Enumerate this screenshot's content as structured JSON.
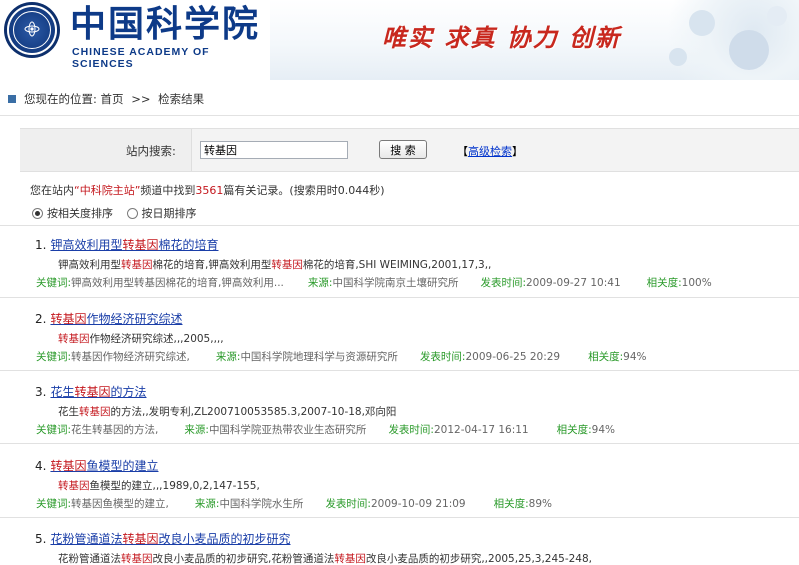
{
  "header": {
    "logo_cn": "中国科学院",
    "logo_en": "CHINESE ACADEMY OF SCIENCES",
    "slogan": "唯实 求真 协力 创新"
  },
  "breadcrumb": {
    "prefix": "您现在的位置:",
    "home": "首页",
    "separator": ">>",
    "current": "检索结果"
  },
  "search": {
    "label": "站内搜索:",
    "value": "转基因",
    "button_label": "搜 索",
    "advanced_open": "【",
    "advanced_label": "高级检索",
    "advanced_close": "】"
  },
  "summary": {
    "text_1": "您在站内",
    "site": "“中科院主站”",
    "text_2": "频道中找到",
    "count": "3561",
    "text_3": "篇有关记录。(搜索用时0.044秒)"
  },
  "sort": {
    "options": [
      {
        "label": "按相关度排序",
        "selected": true
      },
      {
        "label": "按日期排序",
        "selected": false
      }
    ]
  },
  "meta_labels": {
    "keyword": "关键词:",
    "source": "来源:",
    "date": "发表时间:",
    "relevance": "相关度:"
  },
  "results": [
    {
      "num": "1.",
      "title_pre": "钾高效利用型",
      "title_hl": "转基因",
      "title_post": "棉花的培育",
      "desc_1": "钾高效利用型",
      "desc_hl_1": "转基因",
      "desc_2": "棉花的培育,钾高效利用型",
      "desc_hl_2": "转基因",
      "desc_3": "棉花的培育,SHI WEIMING,2001,17,3,,",
      "keyword": "钾高效利用型转基因棉花的培育,钾高效利用...",
      "source": "中国科学院南京土壤研究所",
      "date": "2009-09-27 10:41",
      "relevance": "100%"
    },
    {
      "num": "2.",
      "title_pre": "",
      "title_hl": "转基因",
      "title_post": "作物经济研究综述",
      "desc_1": "",
      "desc_hl_1": "转基因",
      "desc_2": "作物经济研究综述,,,2005,,,,",
      "desc_hl_2": "",
      "desc_3": "",
      "keyword": "转基因作物经济研究综述,",
      "source": "中国科学院地理科学与资源研究所",
      "date": "2009-06-25 20:29",
      "relevance": "94%"
    },
    {
      "num": "3.",
      "title_pre": "花生",
      "title_hl": "转基因",
      "title_post": "的方法",
      "desc_1": "花生",
      "desc_hl_1": "转基因",
      "desc_2": "的方法,,发明专利,ZL200710053585.3,2007-10-18,邓向阳",
      "desc_hl_2": "",
      "desc_3": "",
      "keyword": "花生转基因的方法,",
      "source": "中国科学院亚热带农业生态研究所",
      "date": "2012-04-17 16:11",
      "relevance": "94%"
    },
    {
      "num": "4.",
      "title_pre": "",
      "title_hl": "转基因",
      "title_post": "鱼模型的建立",
      "desc_1": "",
      "desc_hl_1": "转基因",
      "desc_2": "鱼模型的建立,,,1989,0,2,147-155,",
      "desc_hl_2": "",
      "desc_3": "",
      "keyword": "转基因鱼模型的建立,",
      "source": "中国科学院水生所",
      "date": "2009-10-09 21:09",
      "relevance": "89%"
    },
    {
      "num": "5.",
      "title_pre": "花粉管通道法",
      "title_hl": "转基因",
      "title_post": "改良小麦品质的初步研究",
      "desc_1": "花粉管通道法",
      "desc_hl_1": "转基因",
      "desc_2": "改良小麦品质的初步研究,花粉管通道法",
      "desc_hl_2": "转基因",
      "desc_3": "改良小麦品质的初步研究,,2005,25,3,245-248,",
      "keyword": "",
      "source": "",
      "date": "",
      "relevance": ""
    }
  ]
}
